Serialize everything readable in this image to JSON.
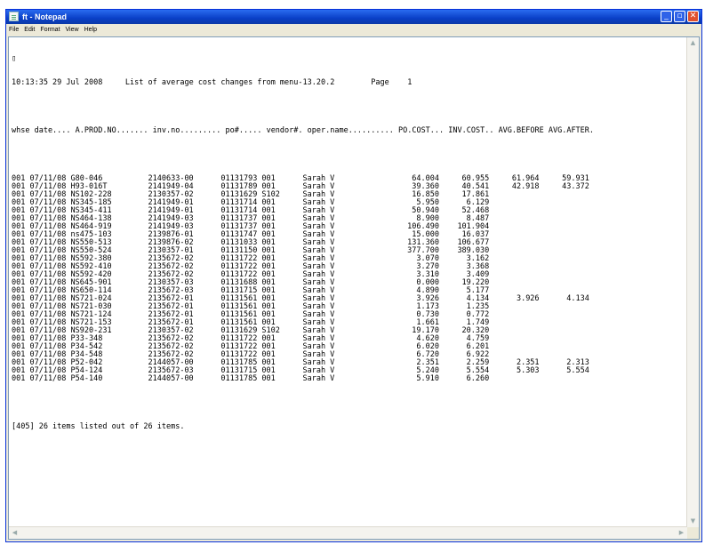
{
  "window": {
    "title": "ft - Notepad"
  },
  "menu": [
    "File",
    "Edit",
    "Format",
    "View",
    "Help"
  ],
  "report": {
    "marker": "▯",
    "header_line": "10:13:35 29 Jul 2008     List of average cost changes from menu-13.20.2        Page    1",
    "columns_line": "whse date.... A.PROD.NO....... inv.no......... po#..... vendor#. oper.name.......... PO.COST... INV.COST.. AVG.BEFORE AVG.AFTER.",
    "rows": [
      {
        "whse": "001",
        "date": "07/11/08",
        "prod": "G80-046",
        "inv": "2140633-00",
        "po": "01131793",
        "vendor": "001",
        "oper": "Sarah V",
        "po_cost": "64.004",
        "inv_cost": "60.955",
        "avg_before": "61.964",
        "avg_after": "59.931"
      },
      {
        "whse": "001",
        "date": "07/11/08",
        "prod": "H93-016T",
        "inv": "2141949-04",
        "po": "01131789",
        "vendor": "001",
        "oper": "Sarah V",
        "po_cost": "39.360",
        "inv_cost": "40.541",
        "avg_before": "42.918",
        "avg_after": "43.372"
      },
      {
        "whse": "001",
        "date": "07/11/08",
        "prod": "NS102-228",
        "inv": "2130357-02",
        "po": "01131629",
        "vendor": "S102",
        "oper": "Sarah V",
        "po_cost": "16.850",
        "inv_cost": "17.861",
        "avg_before": "",
        "avg_after": ""
      },
      {
        "whse": "001",
        "date": "07/11/08",
        "prod": "NS345-185",
        "inv": "2141949-01",
        "po": "01131714",
        "vendor": "001",
        "oper": "Sarah V",
        "po_cost": "5.950",
        "inv_cost": "6.129",
        "avg_before": "",
        "avg_after": ""
      },
      {
        "whse": "001",
        "date": "07/11/08",
        "prod": "NS345-411",
        "inv": "2141949-01",
        "po": "01131714",
        "vendor": "001",
        "oper": "Sarah V",
        "po_cost": "50.940",
        "inv_cost": "52.468",
        "avg_before": "",
        "avg_after": ""
      },
      {
        "whse": "001",
        "date": "07/11/08",
        "prod": "NS464-138",
        "inv": "2141949-03",
        "po": "01131737",
        "vendor": "001",
        "oper": "Sarah V",
        "po_cost": "8.900",
        "inv_cost": "8.487",
        "avg_before": "",
        "avg_after": ""
      },
      {
        "whse": "001",
        "date": "07/11/08",
        "prod": "NS464-919",
        "inv": "2141949-03",
        "po": "01131737",
        "vendor": "001",
        "oper": "Sarah V",
        "po_cost": "106.490",
        "inv_cost": "101.904",
        "avg_before": "",
        "avg_after": ""
      },
      {
        "whse": "001",
        "date": "07/11/08",
        "prod": "ns475-103",
        "inv": "2139876-01",
        "po": "01131747",
        "vendor": "001",
        "oper": "Sarah V",
        "po_cost": "15.000",
        "inv_cost": "16.037",
        "avg_before": "",
        "avg_after": ""
      },
      {
        "whse": "001",
        "date": "07/11/08",
        "prod": "NS550-513",
        "inv": "2139876-02",
        "po": "01131033",
        "vendor": "001",
        "oper": "Sarah V",
        "po_cost": "131.360",
        "inv_cost": "106.677",
        "avg_before": "",
        "avg_after": ""
      },
      {
        "whse": "001",
        "date": "07/11/08",
        "prod": "NS550-524",
        "inv": "2130357-01",
        "po": "01131150",
        "vendor": "001",
        "oper": "Sarah V",
        "po_cost": "377.700",
        "inv_cost": "389.030",
        "avg_before": "",
        "avg_after": ""
      },
      {
        "whse": "001",
        "date": "07/11/08",
        "prod": "NS592-380",
        "inv": "2135672-02",
        "po": "01131722",
        "vendor": "001",
        "oper": "Sarah V",
        "po_cost": "3.070",
        "inv_cost": "3.162",
        "avg_before": "",
        "avg_after": ""
      },
      {
        "whse": "001",
        "date": "07/11/08",
        "prod": "NS592-410",
        "inv": "2135672-02",
        "po": "01131722",
        "vendor": "001",
        "oper": "Sarah V",
        "po_cost": "3.270",
        "inv_cost": "3.368",
        "avg_before": "",
        "avg_after": ""
      },
      {
        "whse": "001",
        "date": "07/11/08",
        "prod": "NS592-420",
        "inv": "2135672-02",
        "po": "01131722",
        "vendor": "001",
        "oper": "Sarah V",
        "po_cost": "3.310",
        "inv_cost": "3.409",
        "avg_before": "",
        "avg_after": ""
      },
      {
        "whse": "001",
        "date": "07/11/08",
        "prod": "NS645-901",
        "inv": "2130357-03",
        "po": "01131688",
        "vendor": "001",
        "oper": "Sarah V",
        "po_cost": "0.000",
        "inv_cost": "19.220",
        "avg_before": "",
        "avg_after": ""
      },
      {
        "whse": "001",
        "date": "07/11/08",
        "prod": "NS650-114",
        "inv": "2135672-03",
        "po": "01131715",
        "vendor": "001",
        "oper": "Sarah V",
        "po_cost": "4.890",
        "inv_cost": "5.177",
        "avg_before": "",
        "avg_after": ""
      },
      {
        "whse": "001",
        "date": "07/11/08",
        "prod": "NS721-024",
        "inv": "2135672-01",
        "po": "01131561",
        "vendor": "001",
        "oper": "Sarah V",
        "po_cost": "3.926",
        "inv_cost": "4.134",
        "avg_before": "3.926",
        "avg_after": "4.134"
      },
      {
        "whse": "001",
        "date": "07/11/08",
        "prod": "NS721-030",
        "inv": "2135672-01",
        "po": "01131561",
        "vendor": "001",
        "oper": "Sarah V",
        "po_cost": "1.173",
        "inv_cost": "1.235",
        "avg_before": "",
        "avg_after": ""
      },
      {
        "whse": "001",
        "date": "07/11/08",
        "prod": "NS721-124",
        "inv": "2135672-01",
        "po": "01131561",
        "vendor": "001",
        "oper": "Sarah V",
        "po_cost": "0.730",
        "inv_cost": "0.772",
        "avg_before": "",
        "avg_after": ""
      },
      {
        "whse": "001",
        "date": "07/11/08",
        "prod": "NS721-153",
        "inv": "2135672-01",
        "po": "01131561",
        "vendor": "001",
        "oper": "Sarah V",
        "po_cost": "1.661",
        "inv_cost": "1.749",
        "avg_before": "",
        "avg_after": ""
      },
      {
        "whse": "001",
        "date": "07/11/08",
        "prod": "NS920-231",
        "inv": "2130357-02",
        "po": "01131629",
        "vendor": "S102",
        "oper": "Sarah V",
        "po_cost": "19.170",
        "inv_cost": "20.320",
        "avg_before": "",
        "avg_after": ""
      },
      {
        "whse": "001",
        "date": "07/11/08",
        "prod": "P33-348",
        "inv": "2135672-02",
        "po": "01131722",
        "vendor": "001",
        "oper": "Sarah V",
        "po_cost": "4.620",
        "inv_cost": "4.759",
        "avg_before": "",
        "avg_after": ""
      },
      {
        "whse": "001",
        "date": "07/11/08",
        "prod": "P34-542",
        "inv": "2135672-02",
        "po": "01131722",
        "vendor": "001",
        "oper": "Sarah V",
        "po_cost": "6.020",
        "inv_cost": "6.201",
        "avg_before": "",
        "avg_after": ""
      },
      {
        "whse": "001",
        "date": "07/11/08",
        "prod": "P34-548",
        "inv": "2135672-02",
        "po": "01131722",
        "vendor": "001",
        "oper": "Sarah V",
        "po_cost": "6.720",
        "inv_cost": "6.922",
        "avg_before": "",
        "avg_after": ""
      },
      {
        "whse": "001",
        "date": "07/11/08",
        "prod": "P52-042",
        "inv": "2144057-00",
        "po": "01131785",
        "vendor": "001",
        "oper": "Sarah V",
        "po_cost": "2.351",
        "inv_cost": "2.259",
        "avg_before": "2.351",
        "avg_after": "2.313"
      },
      {
        "whse": "001",
        "date": "07/11/08",
        "prod": "P54-124",
        "inv": "2135672-03",
        "po": "01131715",
        "vendor": "001",
        "oper": "Sarah V",
        "po_cost": "5.240",
        "inv_cost": "5.554",
        "avg_before": "5.303",
        "avg_after": "5.554"
      },
      {
        "whse": "001",
        "date": "07/11/08",
        "prod": "P54-140",
        "inv": "2144057-00",
        "po": "01131785",
        "vendor": "001",
        "oper": "Sarah V",
        "po_cost": "5.910",
        "inv_cost": "6.260",
        "avg_before": "",
        "avg_after": ""
      }
    ],
    "footer_line": "[405] 26 items listed out of 26 items."
  }
}
